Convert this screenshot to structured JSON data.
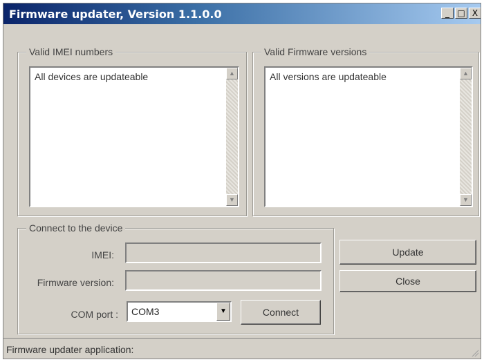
{
  "window": {
    "title": "Firmware updater, Version 1.1.0.0",
    "controls": {
      "minimize": "_",
      "maximize": "□",
      "close": "X"
    }
  },
  "imei_group": {
    "label": "Valid IMEI numbers",
    "items": [
      "All devices are updateable"
    ]
  },
  "fw_group": {
    "label": "Valid Firmware versions",
    "items": [
      "All versions are updateable"
    ]
  },
  "connect_group": {
    "label": "Connect to the device",
    "imei_label": "IMEI:",
    "imei_value": "",
    "fw_label": "Firmware version:",
    "fw_value": "",
    "com_label": "COM port :",
    "com_value": "COM3",
    "connect_button": "Connect"
  },
  "actions": {
    "update_button": "Update",
    "close_button": "Close"
  },
  "status": {
    "text": "Firmware updater application:"
  },
  "icons": {
    "scroll_up": "scroll-up-arrow-icon",
    "scroll_down": "scroll-down-arrow-icon",
    "dropdown": "chevron-down-icon",
    "size_grip": "resize-grip-icon"
  },
  "colors": {
    "title_start": "#0a246a",
    "title_end": "#a6caf0",
    "face": "#d4d0c8"
  }
}
